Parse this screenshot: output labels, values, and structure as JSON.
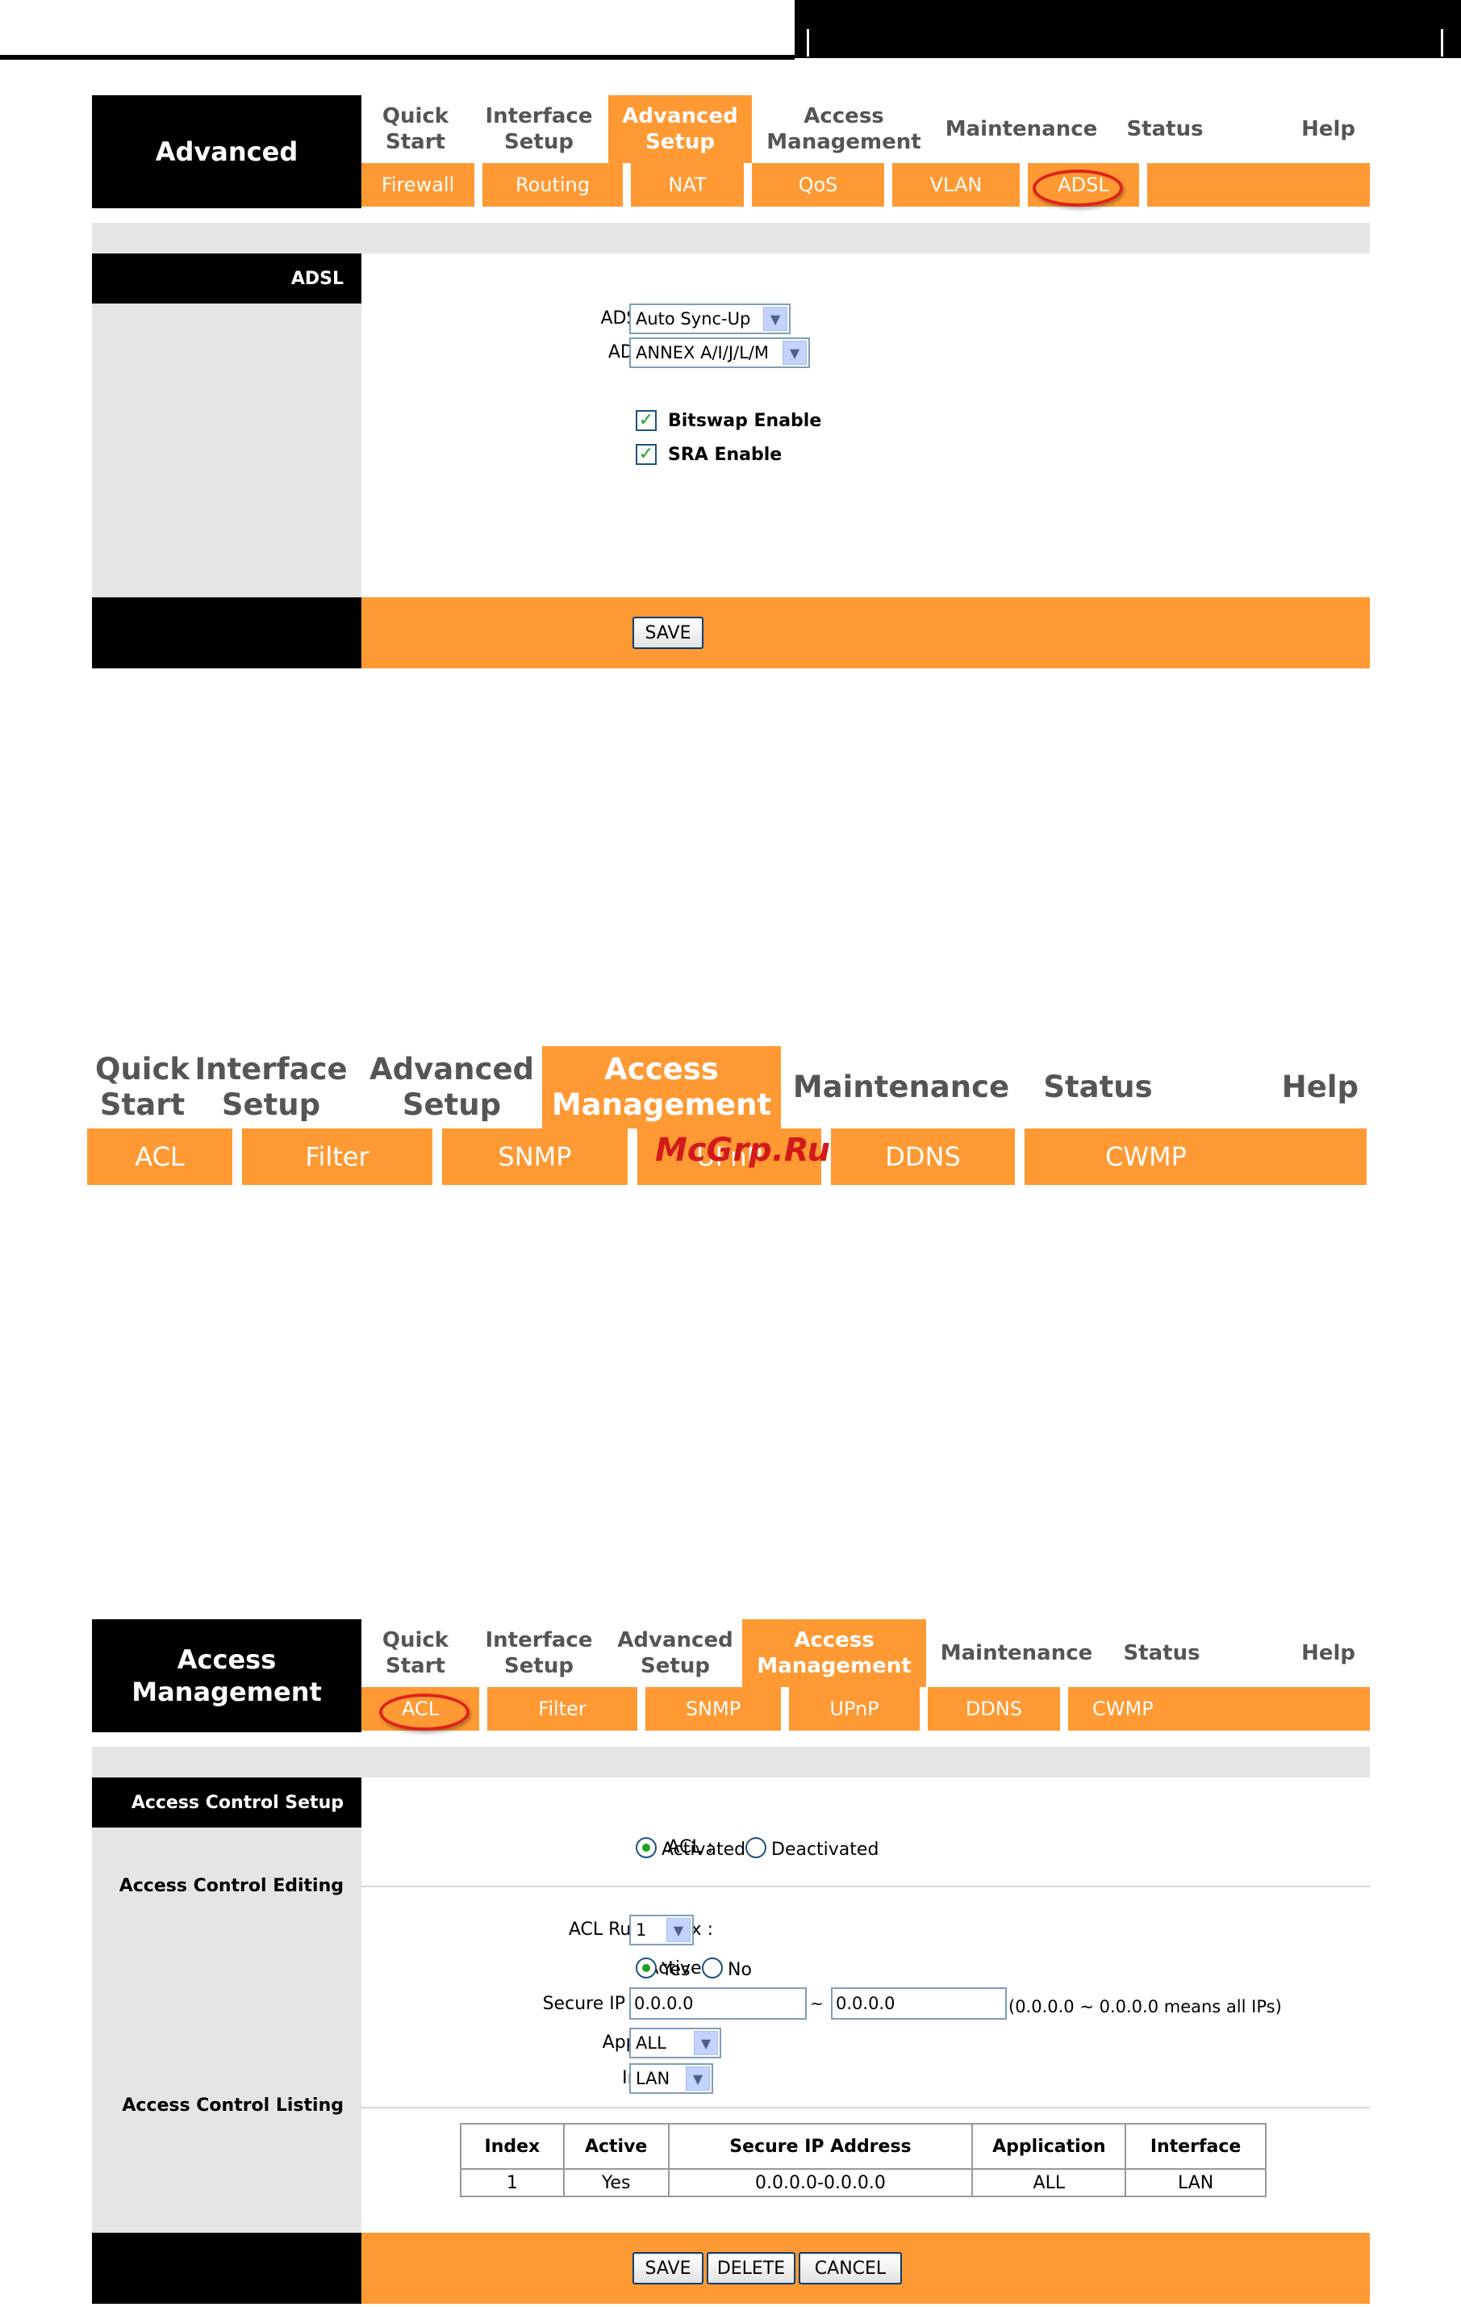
{
  "panel1": {
    "brand": "Advanced",
    "topnav": [
      "Quick Start",
      "Interface Setup",
      "Advanced Setup",
      "Access Management",
      "Maintenance",
      "Status",
      "Help"
    ],
    "subnav": [
      "Firewall",
      "Routing",
      "NAT",
      "QoS",
      "VLAN",
      "ADSL"
    ],
    "section": "ADSL",
    "adsl_mode_label": "ADSL Mode :",
    "adsl_mode_value": "Auto Sync-Up",
    "adsl_type_label": "ADSL Type :",
    "adsl_type_value": "ANNEX A/I/J/L/M",
    "bitswap_label": "Bitswap Enable",
    "sra_label": "SRA Enable",
    "save": "SAVE"
  },
  "middle": {
    "topnav": [
      "Quick Start",
      "Interface Setup",
      "Advanced Setup",
      "Access Management",
      "Maintenance",
      "Status",
      "Help"
    ],
    "subnav": [
      "ACL",
      "Filter",
      "SNMP",
      "UPnP",
      "DDNS",
      "CWMP"
    ],
    "watermark": "McGrp.Ru"
  },
  "panel3": {
    "brand": "Access Management",
    "topnav": [
      "Quick Start",
      "Interface Setup",
      "Advanced Setup",
      "Access Management",
      "Maintenance",
      "Status",
      "Help"
    ],
    "subnav": [
      "ACL",
      "Filter",
      "SNMP",
      "UPnP",
      "DDNS",
      "CWMP"
    ],
    "section_setup": "Access Control Setup",
    "section_editing": "Access Control Editing",
    "section_listing": "Access Control Listing",
    "acl_label": "ACL :",
    "acl_on": "Activated",
    "acl_off": "Deactivated",
    "rule_index_label": "ACL Rule Index :",
    "rule_index_value": "1",
    "active_label": "Active :",
    "active_yes": "Yes",
    "active_no": "No",
    "secure_ip_label": "Secure IP Address :",
    "ip_from": "0.0.0.0",
    "ip_sep": "~",
    "ip_to": "0.0.0.0",
    "ip_hint": "(0.0.0.0 ~ 0.0.0.0 means all IPs)",
    "application_label": "Application :",
    "application_value": "ALL",
    "interface_label": "Interface :",
    "interface_value": "LAN",
    "table": {
      "headers": [
        "Index",
        "Active",
        "Secure IP Address",
        "Application",
        "Interface"
      ],
      "rows": [
        [
          "1",
          "Yes",
          "0.0.0.0-0.0.0.0",
          "ALL",
          "LAN"
        ]
      ]
    },
    "save": "SAVE",
    "delete": "DELETE",
    "cancel": "CANCEL"
  }
}
